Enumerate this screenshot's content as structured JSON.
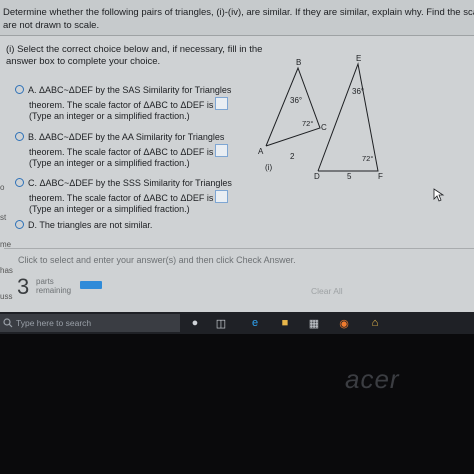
{
  "question": {
    "line1": "Determine whether the following pairs of triangles, (i)-(iv), are similar. If they are similar, explain why. Find the sca",
    "line2": "are not drawn to scale."
  },
  "part": {
    "instruction_line1": "(i) Select the correct choice below and, if necessary, fill in the",
    "instruction_line2": "answer box to complete your choice."
  },
  "choices": [
    {
      "letter": "A.",
      "text": "ΔABC~ΔDEF by the SAS Similarity for Triangles",
      "line2": "theorem. The scale factor of ΔABC to ΔDEF is",
      "line3": "(Type an integer or a simplified fraction.)"
    },
    {
      "letter": "B.",
      "text": "ΔABC~ΔDEF by the AA Similarity for Triangles",
      "line2": "theorem. The scale factor of ΔABC to ΔDEF is",
      "line3": "(Type an integer or a simplified fraction.)"
    },
    {
      "letter": "C.",
      "text": "ΔABC~ΔDEF by the SSS Similarity for Triangles",
      "line2": "theorem. The scale factor of ΔABC to ΔDEF is",
      "line3": "(Type an integer or a simplified fraction.)"
    },
    {
      "letter": "D.",
      "text": "The triangles are not similar."
    }
  ],
  "figure": {
    "label_B": "B",
    "label_A": "A",
    "label_C": "C",
    "label_E": "E",
    "label_D": "D",
    "label_F": "F",
    "angle_B": "36°",
    "angle_C": "72°",
    "angle_E": "36°",
    "angle_F": "72°",
    "side_AC": "2",
    "side_DF": "5",
    "caption": "(i)"
  },
  "left_edge": {
    "e1": "o",
    "e2": "st",
    "e3": "me",
    "e4": "has",
    "e5": "uss"
  },
  "footer": {
    "hint": "Click to select and enter your answer(s) and then click Check Answer.",
    "parts_count": "3",
    "parts_label_1": "parts",
    "parts_label_2": "remaining",
    "clear_all": "Clear All"
  },
  "taskbar": {
    "search_placeholder": "Type here to search"
  },
  "brand": "acer",
  "colors": {
    "accent": "#2f72b8",
    "progress": "#2f8bd9"
  }
}
